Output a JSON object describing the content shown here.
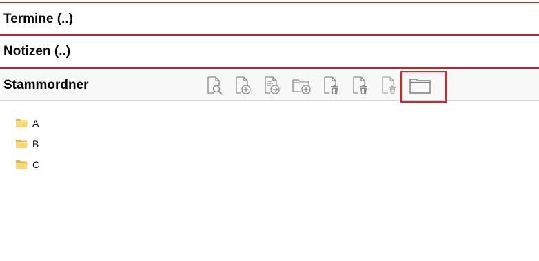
{
  "sections": {
    "termine": {
      "title": "Termine (..)"
    },
    "notizen": {
      "title": "Notizen (..)"
    },
    "stammordner": {
      "title": "Stammordner"
    }
  },
  "toolbar": {
    "buttons": [
      {
        "icon": "document-search-icon"
      },
      {
        "icon": "document-add-icon"
      },
      {
        "icon": "document-move-icon"
      },
      {
        "icon": "folder-add-icon"
      },
      {
        "icon": "document-delete-icon"
      },
      {
        "icon": "document-delete-icon"
      },
      {
        "icon": "document-delete-small-icon"
      },
      {
        "icon": "folder-icon",
        "highlighted": true
      }
    ]
  },
  "tree": {
    "items": [
      {
        "label": "A",
        "icon": "folder-icon"
      },
      {
        "label": "B",
        "icon": "folder-icon"
      },
      {
        "label": "C",
        "icon": "folder-icon"
      }
    ]
  },
  "colors": {
    "section_border": "#b22a2e",
    "highlight": "#e02129",
    "icon_gray": "#8a8a8a",
    "folder_yellow": "#f3c84a"
  }
}
